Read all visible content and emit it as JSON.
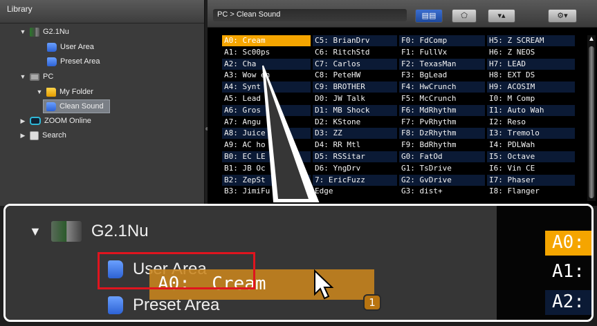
{
  "library": {
    "title": "Library",
    "tree": {
      "device": "G2.1Nu",
      "user_area": "User Area",
      "preset_area": "Preset Area",
      "pc": "PC",
      "my_folder": "My Folder",
      "clean_sound": "Clean Sound",
      "zoom_online": "ZOOM Online",
      "search": "Search"
    }
  },
  "patch_panel": {
    "breadcrumb": "PC > Clean Sound",
    "view_toggle_icon": "list-view-icon",
    "effects_icon": "pentagon-icon",
    "sort_icon": "up-down-arrows-icon",
    "settings_icon": "gear-menu-icon",
    "columns": [
      [
        "A0:  Cream",
        "A1:  Sc00ps",
        "A2:  Cha",
        "A3:  Wow  en",
        "A4:  Synt    h",
        "A5:  Lead",
        "A6:  Gros",
        "A7:  Angu",
        "A8:  Juice",
        "A9:  AC ho",
        "B0:  EC LE",
        "B1:  JB Oc",
        "B2:  ZepSt",
        "B3:  JimiFu"
      ],
      [
        "C5:  BrianDrv",
        "C6:  RitchStd",
        "C7:  Carlos",
        "C8:  PeteHW",
        "C9:  BROTHER",
        "D0:  JW Talk",
        "D1:  MB Shock",
        "D2:  KStone",
        "D3:  ZZ",
        "D4:  RR Mtl",
        "D5:  RSSitar",
        "D6:  YngDrv",
        "7:  EricFuzz",
        "   Edge"
      ],
      [
        "F0:  FdComp",
        "F1:  FullVx",
        "F2:  TexasMan",
        "F3:  BgLead",
        "F4:  HwCrunch",
        "F5:  McCrunch",
        "F6:  MdRhythm",
        "F7:  PvRhythm",
        "F8:  DzRhythm",
        "F9:  BdRhythm",
        "G0:  FatOd",
        "G1:  TsDrive",
        "G2:  GvDrive",
        "G3:  dist+"
      ],
      [
        "H5:  Z SCREAM",
        "H6:  Z NEOS",
        "H7:  LEAD",
        "H8:  EXT DS",
        "H9:  ACOSIM",
        "I0:  M Comp",
        "I1:  Auto Wah",
        "I2:  Reso",
        "I3:  Tremolo",
        "I4:  PDLWah",
        "I5:  Octave",
        "I6:  Vin CE",
        "I7:  Phaser",
        "I8:  Flanger"
      ]
    ]
  },
  "zoom": {
    "device": "G2.1Nu",
    "user_area": "User Area",
    "preset_area": "Preset Area",
    "drag_label": "A0:  Cream",
    "drag_count": "1",
    "right_cells": [
      "A0:",
      "A1:",
      "A2:"
    ]
  },
  "colors": {
    "selection": "#f5a500",
    "row_dark": "#0b1a35",
    "drop_target": "#e0141e",
    "drag_ghost": "#c9851e"
  }
}
